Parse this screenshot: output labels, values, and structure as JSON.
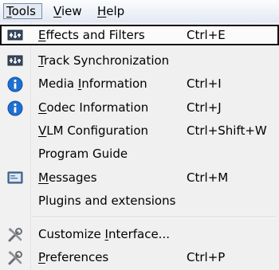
{
  "menubar": {
    "tools": {
      "accel": "T",
      "rest": "ools"
    },
    "view": {
      "accel": "V",
      "rest": "iew"
    },
    "help": {
      "accel": "H",
      "rest": "elp"
    }
  },
  "menu": {
    "items": [
      {
        "accel": "E",
        "rest": "ffects and Filters",
        "shortcut": "Ctrl+E",
        "icon": "equalizer-icon",
        "highlighted": true
      },
      {
        "accel": "T",
        "rest": "rack Synchronization",
        "shortcut": "",
        "icon": "equalizer-icon"
      },
      {
        "accel": "",
        "pre": "Media ",
        "accel_mid": "I",
        "rest": "nformation",
        "shortcut": "Ctrl+I",
        "icon": "info-icon"
      },
      {
        "accel": "C",
        "rest": "odec Information",
        "shortcut": "Ctrl+J",
        "icon": "info-icon"
      },
      {
        "accel": "V",
        "rest": "LM Configuration",
        "shortcut": "Ctrl+Shift+W",
        "icon": ""
      },
      {
        "accel": "",
        "rest": "Program Guide",
        "shortcut": "",
        "icon": ""
      },
      {
        "accel": "M",
        "rest": "essages",
        "shortcut": "Ctrl+M",
        "icon": "terminal-icon"
      },
      {
        "accel": "",
        "rest": "Plugins and extensions",
        "shortcut": "",
        "icon": ""
      },
      {
        "accel": "",
        "pre": "Customize ",
        "accel_mid": "I",
        "rest": "nterface...",
        "shortcut": "",
        "icon": "tools-icon"
      },
      {
        "accel": "P",
        "rest": "references",
        "shortcut": "Ctrl+P",
        "icon": "tools-icon"
      }
    ]
  },
  "colors": {
    "info_blue": "#1f6fd1",
    "highlight_border": "#111111"
  }
}
